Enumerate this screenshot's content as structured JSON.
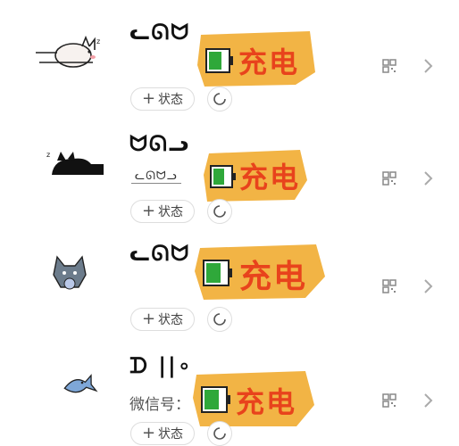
{
  "rows": [
    {
      "name": "ᓚᘏᗢ",
      "subtitle": "",
      "avatar": "sleeping-white-cat",
      "sticker_text": "充电",
      "status_label": "状态"
    },
    {
      "name": "ᗢᘏᓗ",
      "subtitle": "",
      "avatar": "sleeping-black-cat",
      "sticker_text": "充电",
      "status_label": "状态"
    },
    {
      "name": "ᓚᘏᗢ",
      "subtitle": "",
      "avatar": "grey-fluffy-cat",
      "sticker_text": "充电",
      "status_label": "状态"
    },
    {
      "name": "ᗪ ||∘",
      "subtitle": "微信号：",
      "avatar": "small-fish",
      "sticker_text": "充电",
      "status_label": "状态"
    }
  ],
  "colors": {
    "sticker_bg": "#f2b445",
    "sticker_text": "#e8431c",
    "battery": "#2fa83a"
  },
  "icons": {
    "qr": "qr-code-icon",
    "chevron": "chevron-right-icon",
    "ring": "status-ring-icon",
    "plus": "plus-icon"
  }
}
